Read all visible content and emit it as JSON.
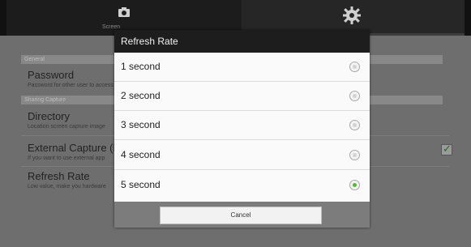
{
  "tabs": {
    "left_label": "Screen",
    "left_icon": "camera-icon",
    "right_icon": "gear-icon"
  },
  "settings": {
    "general_header": "General",
    "password_title": "Password",
    "password_sub": "Password for other user to access",
    "sharing_header": "Sharing Capture",
    "directory_title": "Directory",
    "directory_sub": "Location screen capture image",
    "external_title": "External Capture (N",
    "external_sub": "If you want to use external app",
    "external_checked": true,
    "refresh_title": "Refresh Rate",
    "refresh_sub": "Low value, make you hardware"
  },
  "dialog": {
    "title": "Refresh Rate",
    "options": [
      {
        "label": "1 second",
        "selected": false
      },
      {
        "label": "2 second",
        "selected": false
      },
      {
        "label": "3 second",
        "selected": false
      },
      {
        "label": "4 second",
        "selected": false
      },
      {
        "label": "5 second",
        "selected": true
      }
    ],
    "cancel_label": "Cancel"
  },
  "colors": {
    "selected_radio": "#4fbe2e",
    "dialog_title_bg": "#1d1d1d"
  }
}
